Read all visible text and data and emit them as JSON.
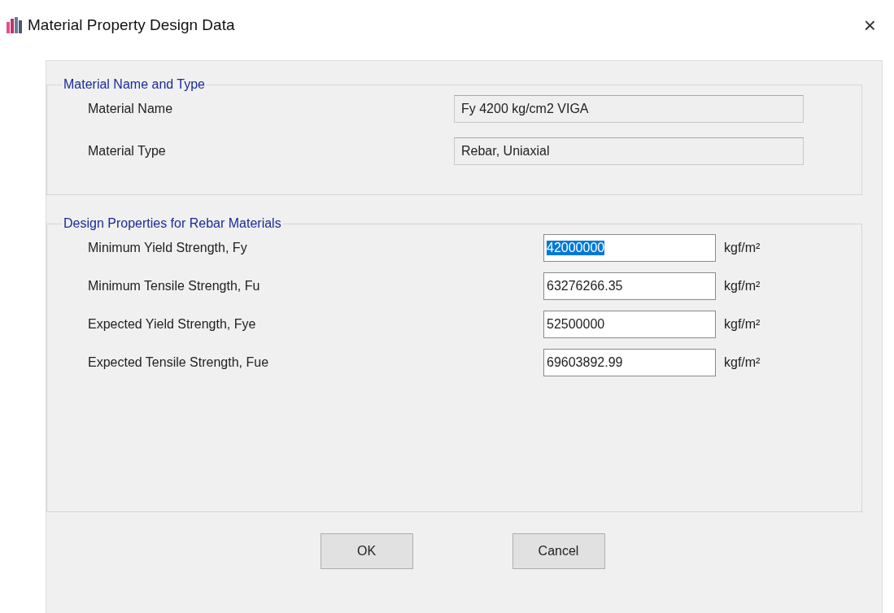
{
  "window": {
    "title": "Material Property Design Data",
    "close": "×"
  },
  "groups": [
    {
      "title": "Material Name and Type",
      "kind": "readonly",
      "rows": [
        {
          "label": "Material Name",
          "value": "Fy 4200 kg/cm2 VIGA"
        },
        {
          "label": "Material Type",
          "value": "Rebar, Uniaxial"
        }
      ]
    },
    {
      "title": "Design Properties for Rebar Materials",
      "kind": "input",
      "rows": [
        {
          "label": "Minimum Yield Strength, Fy",
          "value": "42000000",
          "unit": "kgf/m²",
          "text_selected": true
        },
        {
          "label": "Minimum Tensile Strength, Fu",
          "value": "63276266.35",
          "unit": "kgf/m²",
          "text_selected": false
        },
        {
          "label": "Expected Yield Strength, Fye",
          "value": "52500000",
          "unit": "kgf/m²",
          "text_selected": false
        },
        {
          "label": "Expected Tensile Strength, Fue",
          "value": "69603892.99",
          "unit": "kgf/m²",
          "text_selected": false
        }
      ]
    }
  ],
  "buttons": [
    "OK",
    "Cancel"
  ]
}
